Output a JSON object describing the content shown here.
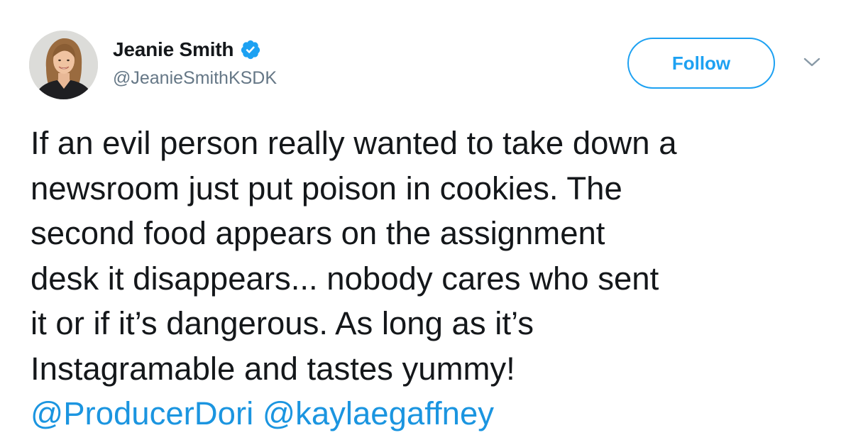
{
  "author": {
    "display_name": "Jeanie Smith",
    "handle": "@JeanieSmithKSDK",
    "verified": true,
    "avatar_icon": "profile-photo"
  },
  "actions": {
    "follow_label": "Follow",
    "more_icon": "chevron-down-icon"
  },
  "tweet": {
    "lines": [
      "If an evil person really wanted to take down a",
      "newsroom just put poison in cookies. The",
      "second food appears on the assignment",
      "desk it disappears... nobody cares who sent",
      "it or if it’s dangerous. As long as it’s",
      "Instagramable and tastes yummy!"
    ],
    "mentions": [
      "@ProducerDori",
      "@kaylaegaffney"
    ]
  },
  "colors": {
    "brand_blue": "#1da1f2",
    "mention_blue": "#1b95e0",
    "text": "#14171a",
    "secondary_text": "#657786"
  }
}
